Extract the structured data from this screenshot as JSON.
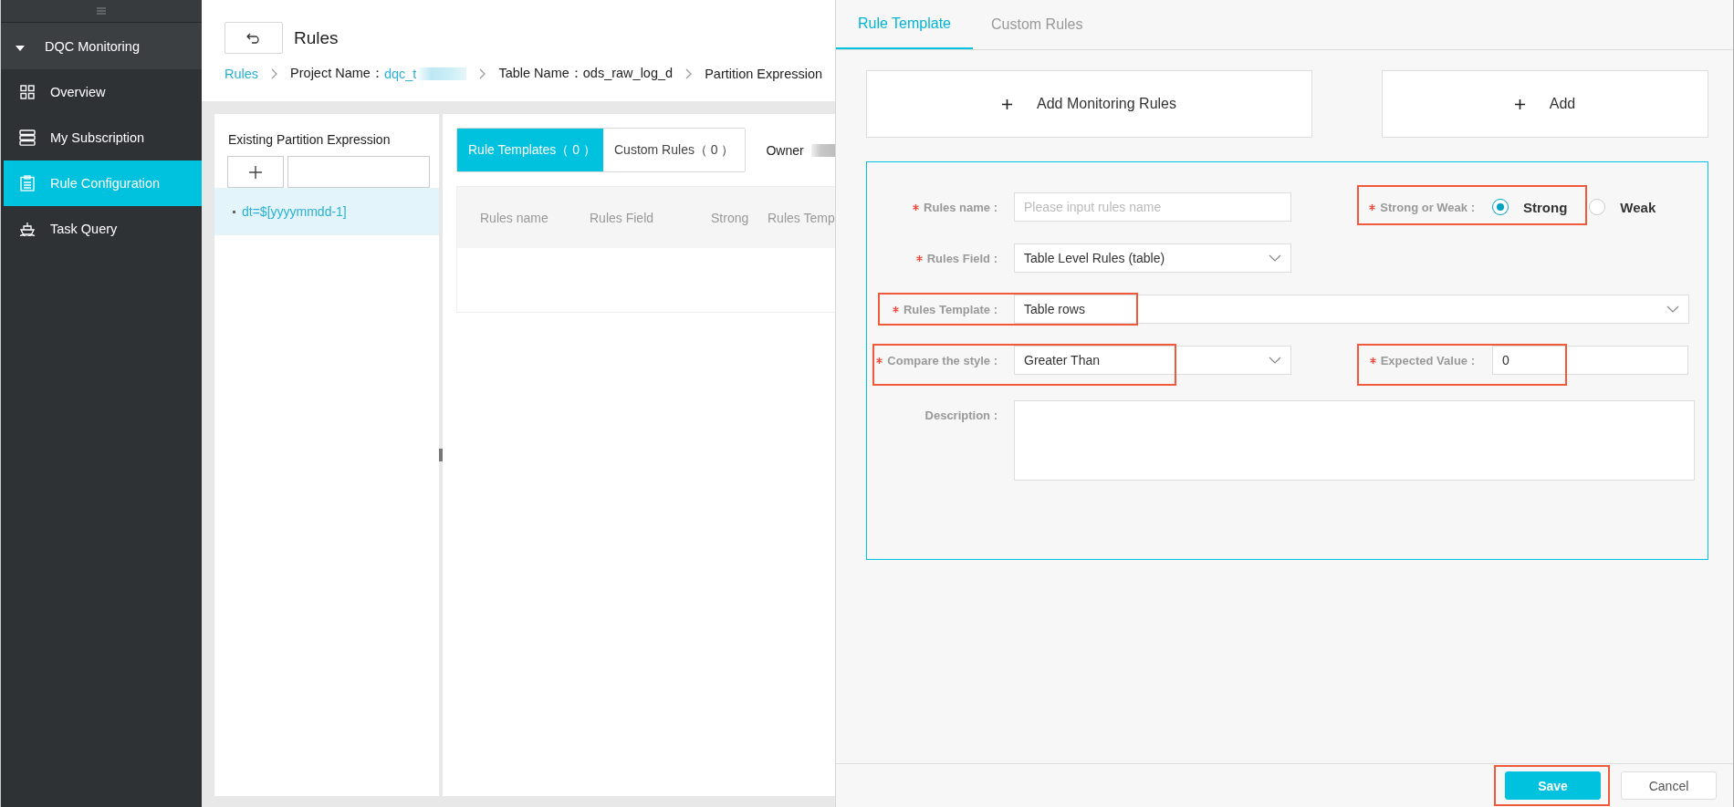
{
  "sidebar": {
    "group": {
      "title": "DQC Monitoring",
      "expanded": true
    },
    "items": [
      {
        "label": "Overview",
        "selected": false
      },
      {
        "label": "My Subscription",
        "selected": false
      },
      {
        "label": "Rule Configuration",
        "selected": true
      },
      {
        "label": "Task Query",
        "selected": false
      }
    ]
  },
  "header": {
    "title": "Rules",
    "breadcrumb": [
      {
        "label": "Rules",
        "kind": "link"
      },
      {
        "label": "Project Name：",
        "link": "dqc_t",
        "redacted": true,
        "kind": "pair"
      },
      {
        "label": "Table Name：ods_raw_log_d",
        "kind": "plain"
      },
      {
        "label": "Partition Expression",
        "kind": "plain"
      }
    ]
  },
  "partitions": {
    "title": "Existing Partition Expression",
    "items": [
      {
        "label": "dt=$[yyyymmdd-1]",
        "selected": true
      }
    ]
  },
  "rules": {
    "tabs": [
      {
        "label": "Rule Templates（ 0 ）",
        "selected": true
      },
      {
        "label": "Custom Rules（ 0 ）",
        "selected": false
      }
    ],
    "owner": {
      "label": "Owner",
      "redacted": true
    },
    "table": {
      "columns": [
        "Rules name",
        "Rules Field",
        "Strong",
        "Rules Temp"
      ]
    }
  },
  "drawer": {
    "tabs": [
      {
        "label": "Rule Template",
        "selected": true
      },
      {
        "label": "Custom Rules",
        "selected": false
      }
    ],
    "add_buttons": [
      "Add Monitoring Rules",
      "Add"
    ],
    "form": {
      "rows": [
        [
          {
            "kind": "text",
            "label": "Rules name :",
            "required": true,
            "placeholder": "Please input rules name",
            "highlighted": false
          },
          {
            "kind": "radio",
            "label": "Strong or Weak :",
            "required": true,
            "highlighted": true,
            "options": [
              {
                "label": "Strong",
                "selected": true
              },
              {
                "label": "Weak",
                "selected": false
              }
            ]
          }
        ],
        [
          {
            "kind": "select",
            "label": "Rules Field :",
            "required": true,
            "value": "Table Level Rules (table)",
            "highlighted": false
          }
        ],
        [
          {
            "kind": "wideselect",
            "label": "Rules Template :",
            "required": true,
            "value": "Table rows",
            "highlighted": true
          }
        ],
        [
          {
            "kind": "select",
            "label": "Compare the style :",
            "required": true,
            "value": "Greater Than",
            "highlighted": true
          },
          {
            "kind": "text",
            "label": "Expected Value :",
            "required": true,
            "value": "0",
            "highlighted": true
          }
        ],
        [
          {
            "kind": "textarea",
            "label": "Description :",
            "required": false,
            "highlighted": false
          }
        ]
      ]
    },
    "footer": {
      "buttons": [
        {
          "label": "Save",
          "kind": "primary",
          "highlighted": true
        },
        {
          "label": "Cancel",
          "kind": "default",
          "highlighted": false
        }
      ]
    }
  }
}
